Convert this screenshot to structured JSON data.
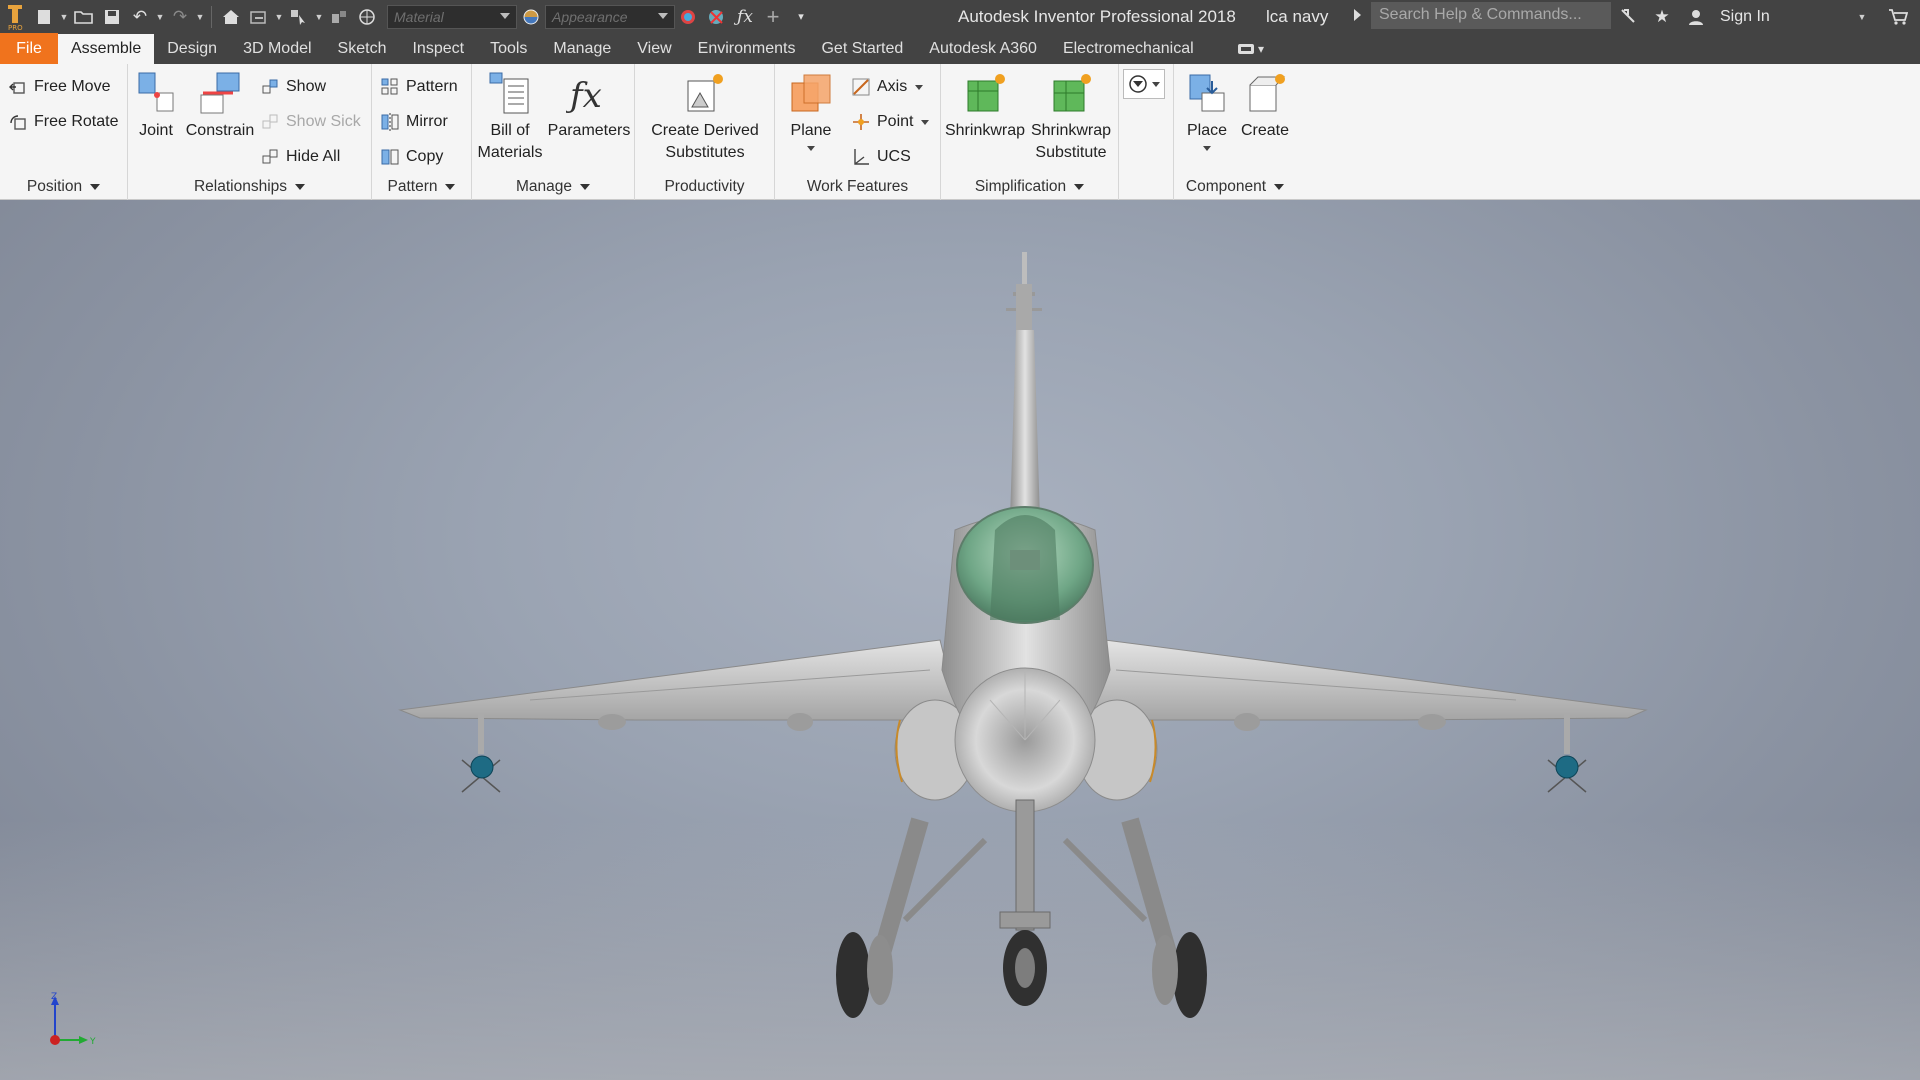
{
  "titlebar": {
    "app_title": "Autodesk Inventor Professional 2018",
    "document": "lca navy",
    "material_placeholder": "Material",
    "appearance_placeholder": "Appearance",
    "search_placeholder": "Search Help & Commands...",
    "signin": "Sign In"
  },
  "tabs": [
    "File",
    "Assemble",
    "Design",
    "3D Model",
    "Sketch",
    "Inspect",
    "Tools",
    "Manage",
    "View",
    "Environments",
    "Get Started",
    "Autodesk A360",
    "Electromechanical"
  ],
  "active_tab": "Assemble",
  "ribbon": {
    "position": {
      "title": "Position",
      "free_move": "Free Move",
      "free_rotate": "Free Rotate"
    },
    "relationships": {
      "title": "Relationships",
      "joint": "Joint",
      "constrain": "Constrain",
      "show": "Show",
      "show_sick": "Show Sick",
      "hide_all": "Hide All"
    },
    "pattern": {
      "title": "Pattern",
      "pattern": "Pattern",
      "mirror": "Mirror",
      "copy": "Copy"
    },
    "manage": {
      "title": "Manage",
      "bom_line1": "Bill of",
      "bom_line2": "Materials",
      "parameters": "Parameters"
    },
    "productivity": {
      "title": "Productivity",
      "cds_line1": "Create Derived",
      "cds_line2": "Substitutes"
    },
    "work_features": {
      "title": "Work Features",
      "plane": "Plane",
      "axis": "Axis",
      "point": "Point",
      "ucs": "UCS"
    },
    "simplification": {
      "title": "Simplification",
      "shrinkwrap": "Shrinkwrap",
      "sws_line1": "Shrinkwrap",
      "sws_line2": "Substitute"
    },
    "component": {
      "title": "Component",
      "place": "Place",
      "create": "Create"
    }
  },
  "triad": {
    "z": "Z",
    "y": "Y"
  },
  "colors": {
    "file_tab": "#f0731d",
    "chrome": "#434343",
    "ribbon": "#f5f5f5"
  }
}
